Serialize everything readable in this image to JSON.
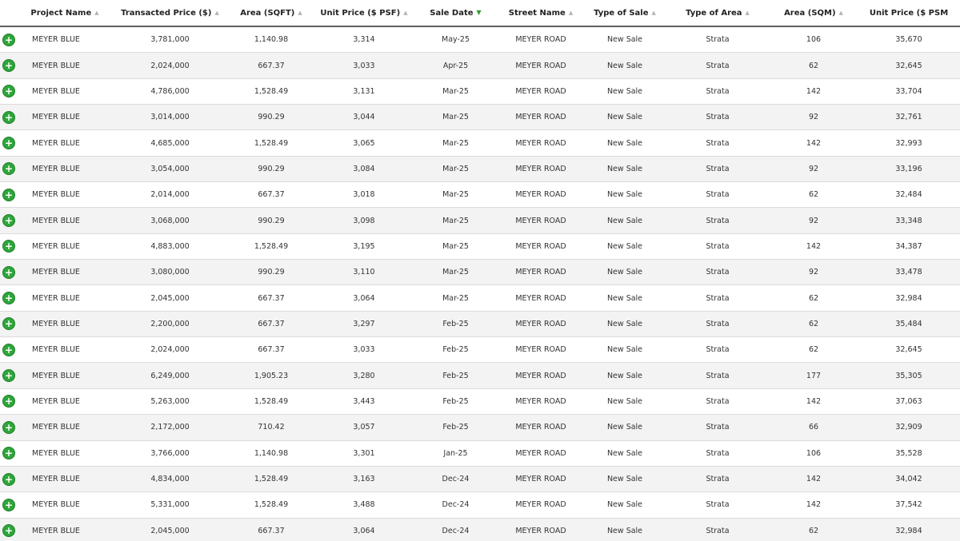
{
  "columns": [
    {
      "label": "Project Name",
      "sort": "none"
    },
    {
      "label": "Transacted Price ($)",
      "sort": "none"
    },
    {
      "label": "Area (SQFT)",
      "sort": "none"
    },
    {
      "label": "Unit Price ($ PSF)",
      "sort": "none"
    },
    {
      "label": "Sale Date",
      "sort": "desc"
    },
    {
      "label": "Street Name",
      "sort": "none"
    },
    {
      "label": "Type of Sale",
      "sort": "none"
    },
    {
      "label": "Type of Area",
      "sort": "none"
    },
    {
      "label": "Area (SQM)",
      "sort": "none"
    },
    {
      "label": "Unit Price ($ PSM",
      "sort": "none"
    }
  ],
  "expand_glyph": "+",
  "sort_up_glyph": "▲",
  "sort_down_glyph": "▼",
  "rows": [
    [
      "MEYER BLUE",
      "3,781,000",
      "1,140.98",
      "3,314",
      "May-25",
      "MEYER ROAD",
      "New Sale",
      "Strata",
      "106",
      "35,670"
    ],
    [
      "MEYER BLUE",
      "2,024,000",
      "667.37",
      "3,033",
      "Apr-25",
      "MEYER ROAD",
      "New Sale",
      "Strata",
      "62",
      "32,645"
    ],
    [
      "MEYER BLUE",
      "4,786,000",
      "1,528.49",
      "3,131",
      "Mar-25",
      "MEYER ROAD",
      "New Sale",
      "Strata",
      "142",
      "33,704"
    ],
    [
      "MEYER BLUE",
      "3,014,000",
      "990.29",
      "3,044",
      "Mar-25",
      "MEYER ROAD",
      "New Sale",
      "Strata",
      "92",
      "32,761"
    ],
    [
      "MEYER BLUE",
      "4,685,000",
      "1,528.49",
      "3,065",
      "Mar-25",
      "MEYER ROAD",
      "New Sale",
      "Strata",
      "142",
      "32,993"
    ],
    [
      "MEYER BLUE",
      "3,054,000",
      "990.29",
      "3,084",
      "Mar-25",
      "MEYER ROAD",
      "New Sale",
      "Strata",
      "92",
      "33,196"
    ],
    [
      "MEYER BLUE",
      "2,014,000",
      "667.37",
      "3,018",
      "Mar-25",
      "MEYER ROAD",
      "New Sale",
      "Strata",
      "62",
      "32,484"
    ],
    [
      "MEYER BLUE",
      "3,068,000",
      "990.29",
      "3,098",
      "Mar-25",
      "MEYER ROAD",
      "New Sale",
      "Strata",
      "92",
      "33,348"
    ],
    [
      "MEYER BLUE",
      "4,883,000",
      "1,528.49",
      "3,195",
      "Mar-25",
      "MEYER ROAD",
      "New Sale",
      "Strata",
      "142",
      "34,387"
    ],
    [
      "MEYER BLUE",
      "3,080,000",
      "990.29",
      "3,110",
      "Mar-25",
      "MEYER ROAD",
      "New Sale",
      "Strata",
      "92",
      "33,478"
    ],
    [
      "MEYER BLUE",
      "2,045,000",
      "667.37",
      "3,064",
      "Mar-25",
      "MEYER ROAD",
      "New Sale",
      "Strata",
      "62",
      "32,984"
    ],
    [
      "MEYER BLUE",
      "2,200,000",
      "667.37",
      "3,297",
      "Feb-25",
      "MEYER ROAD",
      "New Sale",
      "Strata",
      "62",
      "35,484"
    ],
    [
      "MEYER BLUE",
      "2,024,000",
      "667.37",
      "3,033",
      "Feb-25",
      "MEYER ROAD",
      "New Sale",
      "Strata",
      "62",
      "32,645"
    ],
    [
      "MEYER BLUE",
      "6,249,000",
      "1,905.23",
      "3,280",
      "Feb-25",
      "MEYER ROAD",
      "New Sale",
      "Strata",
      "177",
      "35,305"
    ],
    [
      "MEYER BLUE",
      "5,263,000",
      "1,528.49",
      "3,443",
      "Feb-25",
      "MEYER ROAD",
      "New Sale",
      "Strata",
      "142",
      "37,063"
    ],
    [
      "MEYER BLUE",
      "2,172,000",
      "710.42",
      "3,057",
      "Feb-25",
      "MEYER ROAD",
      "New Sale",
      "Strata",
      "66",
      "32,909"
    ],
    [
      "MEYER BLUE",
      "3,766,000",
      "1,140.98",
      "3,301",
      "Jan-25",
      "MEYER ROAD",
      "New Sale",
      "Strata",
      "106",
      "35,528"
    ],
    [
      "MEYER BLUE",
      "4,834,000",
      "1,528.49",
      "3,163",
      "Dec-24",
      "MEYER ROAD",
      "New Sale",
      "Strata",
      "142",
      "34,042"
    ],
    [
      "MEYER BLUE",
      "5,331,000",
      "1,528.49",
      "3,488",
      "Dec-24",
      "MEYER ROAD",
      "New Sale",
      "Strata",
      "142",
      "37,542"
    ],
    [
      "MEYER BLUE",
      "2,045,000",
      "667.37",
      "3,064",
      "Dec-24",
      "MEYER ROAD",
      "New Sale",
      "Strata",
      "62",
      "32,984"
    ]
  ]
}
